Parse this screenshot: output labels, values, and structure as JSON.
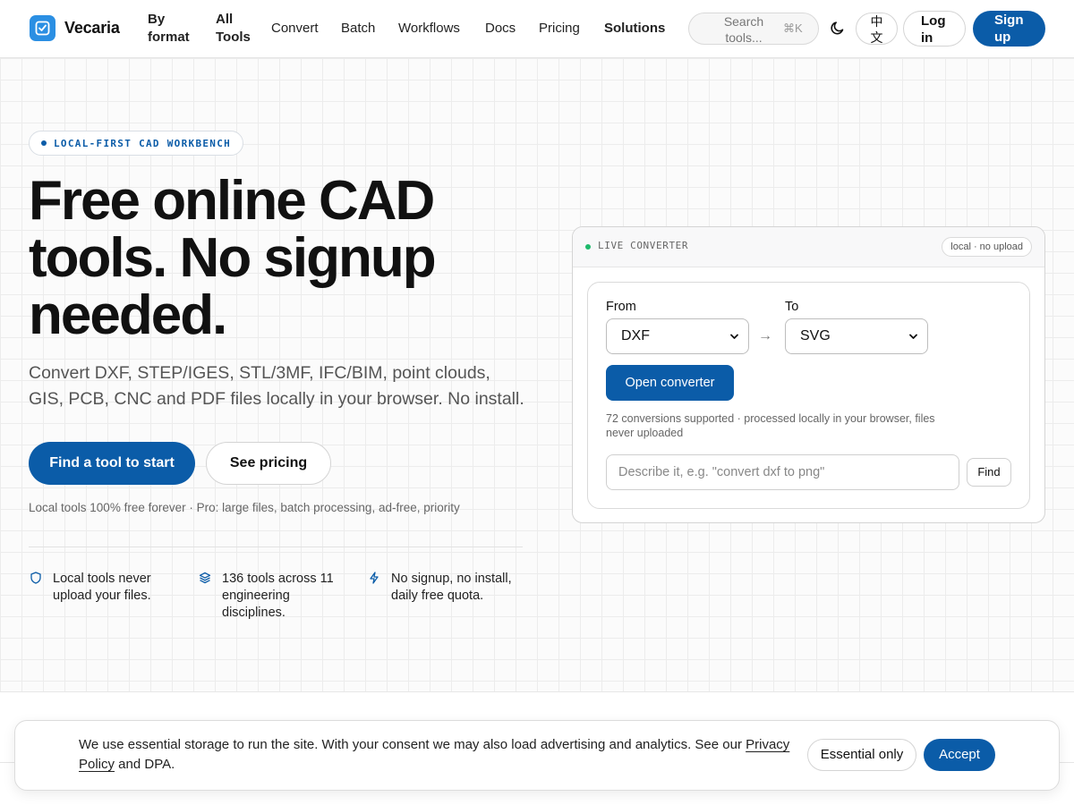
{
  "nav": {
    "brand": "Vecaria",
    "links": [
      "By format",
      "All Tools",
      "Convert",
      "Batch",
      "Workflows",
      "Docs",
      "Pricing",
      "Solutions"
    ],
    "search_placeholder": "Search tools...",
    "search_shortcut": "⌘K",
    "language": "中文",
    "login": "Log in",
    "signup": "Sign up"
  },
  "hero": {
    "badge": "LOCAL-FIRST CAD WORKBENCH",
    "headline": "Free online CAD tools. No signup needed.",
    "subtitle": "Convert DXF, STEP/IGES, STL/3MF, IFC/BIM, point clouds, GIS, PCB, CNC and PDF files locally in your browser. No install.",
    "cta_primary": "Find a tool to start",
    "cta_secondary": "See pricing",
    "note": "Local tools 100% free forever · Pro: large files, batch processing, ad-free, priority",
    "features": [
      {
        "icon": "shield-icon",
        "text": "Local tools never upload your files."
      },
      {
        "icon": "layers-icon",
        "text": "136 tools across 11 engineering disciplines."
      },
      {
        "icon": "bolt-icon",
        "text": "No signup, no install, daily free quota."
      }
    ]
  },
  "converter": {
    "title": "LIVE CONVERTER",
    "pill": "local · no upload",
    "from_label": "From",
    "from_value": "DXF",
    "to_label": "To",
    "to_value": "SVG",
    "arrow": "→",
    "open_button": "Open converter",
    "info": "72 conversions supported · processed locally in your browser, files never uploaded",
    "describe_placeholder": "Describe it, e.g. \"convert dxf to png\"",
    "find_button": "Find"
  },
  "cookie": {
    "message_pre": "We use essential storage to run the site. With your consent we may also load advertising and analytics. See our ",
    "privacy_link": "Privacy Policy",
    "message_post": " and DPA.",
    "essential_button": "Essential only",
    "accept_button": "Accept"
  },
  "colors": {
    "accent": "#0b5ca8",
    "logo": "#2b8fe3",
    "live_dot": "#1db96b"
  }
}
